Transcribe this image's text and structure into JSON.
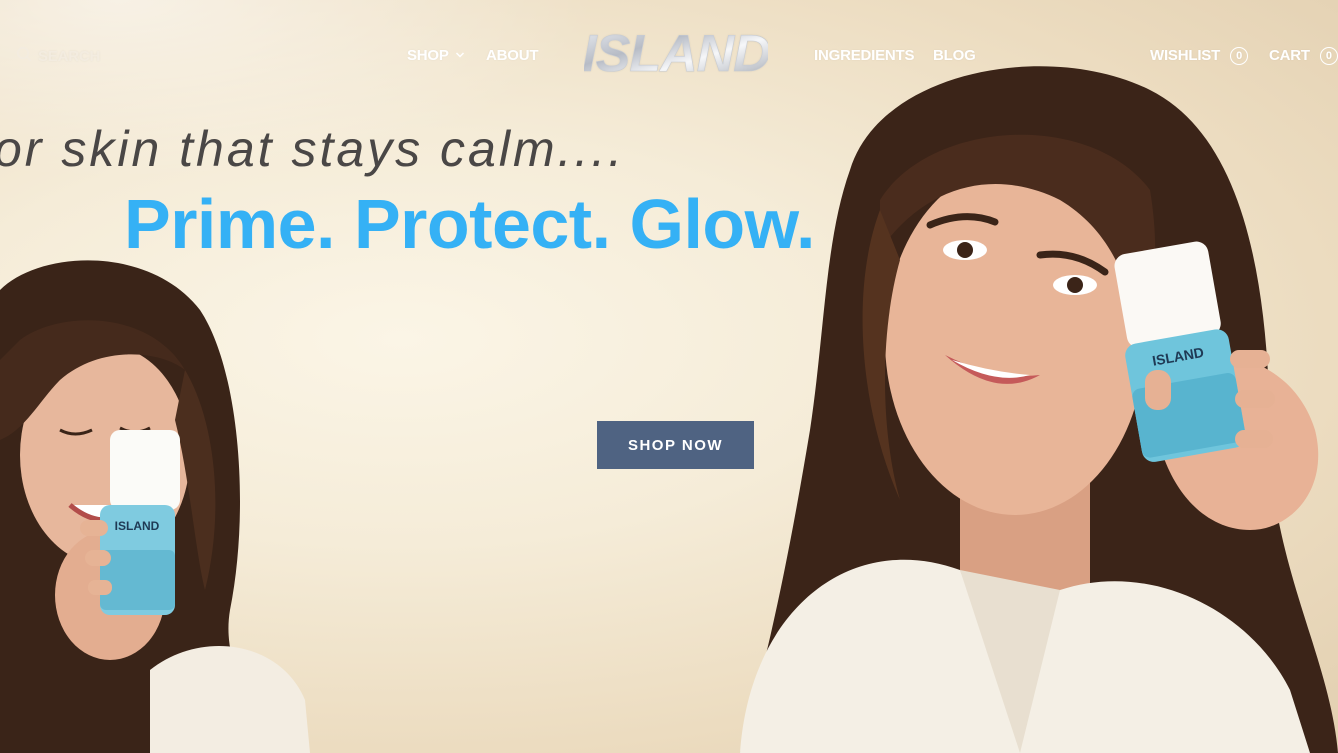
{
  "nav": {
    "search_label": "SEARCH",
    "shop_label": "SHOP",
    "about_label": "ABOUT",
    "ingredients_label": "INGREDIENTS",
    "blog_label": "BLOG",
    "wishlist_label": "WISHLIST",
    "wishlist_count": "0",
    "cart_label": "CART",
    "cart_count": "0"
  },
  "brand": {
    "logo_text": "ISLAND"
  },
  "hero": {
    "tagline": "or skin that stays calm....",
    "headline": "Prime. Protect. Glow.",
    "cta_label": "SHOP NOW",
    "product_label": "ISLAND"
  },
  "colors": {
    "headline": "#35b1f5",
    "tagline": "#4a4746",
    "cta_background": "#4f6382",
    "background": "#f5ecd8",
    "product_bottle": "#5fc0d6"
  },
  "icons": {
    "search": "search-icon",
    "shop_dropdown": "chevron-down-icon"
  }
}
